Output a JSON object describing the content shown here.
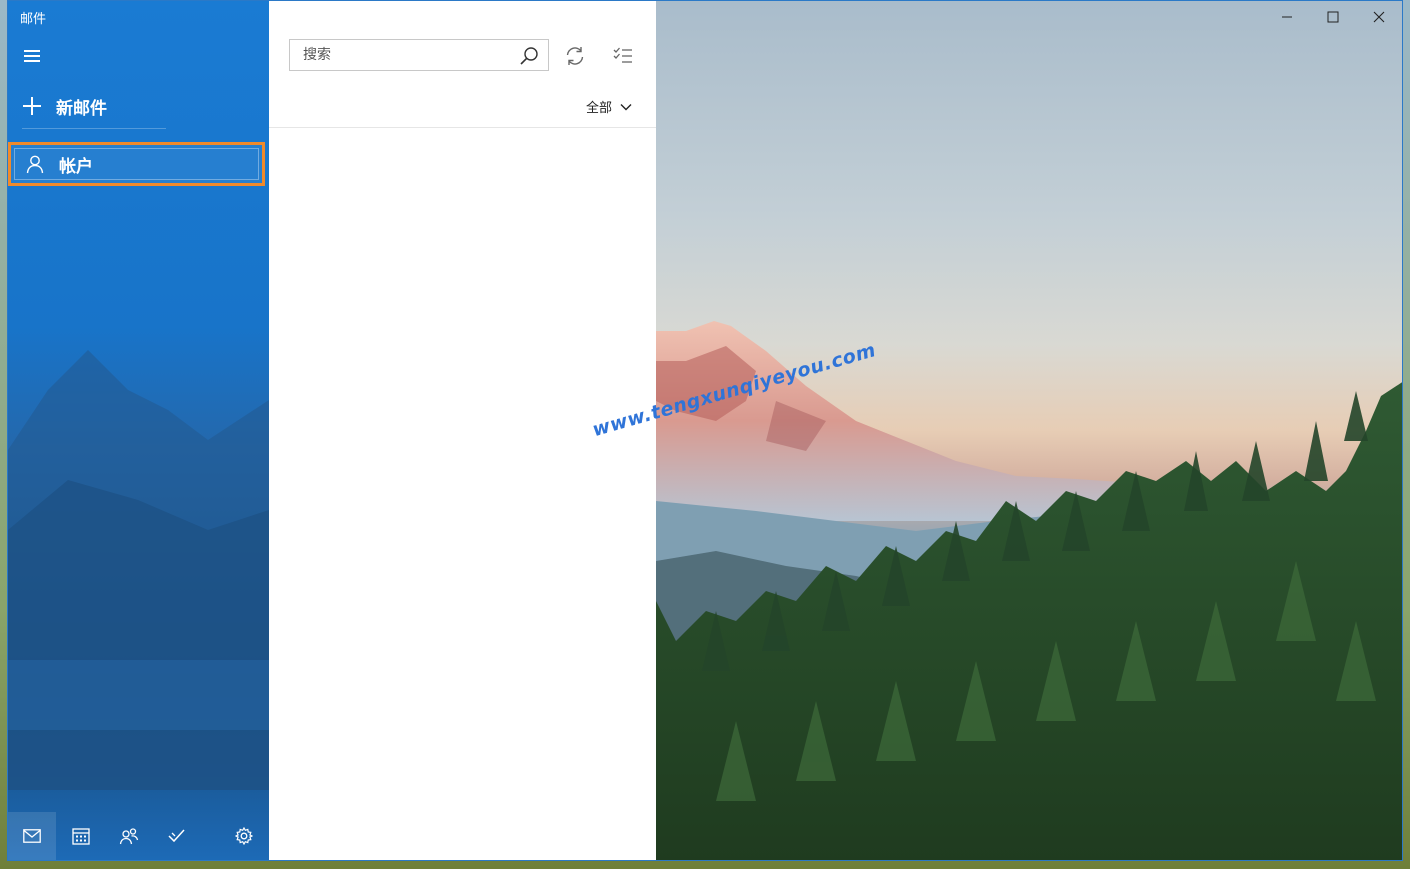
{
  "window": {
    "title": "邮件"
  },
  "nav": {
    "new_mail_label": "新邮件",
    "account_label": "帐户",
    "bottom_icons": [
      "mail-icon",
      "calendar-icon",
      "people-icon",
      "todo-icon",
      "settings-icon"
    ]
  },
  "list": {
    "search_placeholder": "搜索",
    "filter_label": "全部"
  },
  "watermark": "www.tengxunqiyeyou.com",
  "colors": {
    "nav_blue": "#1a7bd3",
    "highlight_orange": "#f08a2b",
    "watermark_blue": "#2f74d8"
  }
}
